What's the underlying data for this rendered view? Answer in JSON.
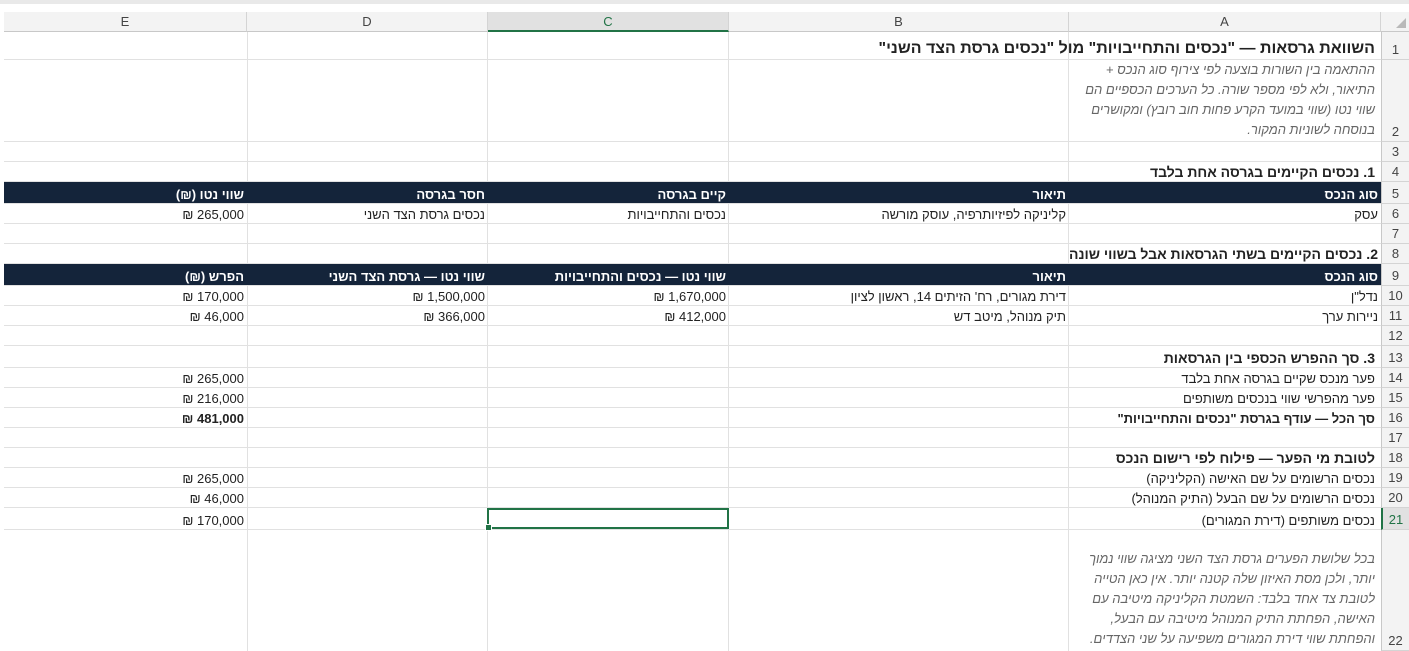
{
  "columns": [
    "E",
    "D",
    "C",
    "B",
    "A"
  ],
  "rows": [
    "1",
    "2",
    "3",
    "4",
    "5",
    "6",
    "7",
    "8",
    "9",
    "10",
    "11",
    "12",
    "13",
    "14",
    "15",
    "16",
    "17",
    "18",
    "19",
    "20",
    "21",
    "22"
  ],
  "title": "השוואת גרסאות — \"נכסים והתחייבויות\" מול \"נכסים גרסת הצד השני\"",
  "intro_note": "ההתאמה בין השורות בוצעה לפי צירוף סוג הנכס + התיאור, ולא לפי מספר שורה. כל הערכים הכספיים הם שווי נטו (שווי במועד הקרע פחות חוב רובץ) ומקושרים בנוסחה לשוניות המקור.",
  "section1": {
    "title": "1. נכסים הקיימים בגרסה אחת בלבד",
    "headers": [
      "סוג הנכס",
      "תיאור",
      "קיים בגרסה",
      "חסר בגרסה",
      "שווי נטו (₪)"
    ],
    "rows": [
      [
        "עסק",
        "קליניקה לפיזיותרפיה, עוסק מורשה",
        "נכסים והתחייבויות",
        "נכסים גרסת הצד השני",
        "₪ 265,000"
      ]
    ]
  },
  "section2": {
    "title": "2. נכסים הקיימים בשתי הגרסאות אבל בשווי שונה",
    "headers": [
      "סוג הנכס",
      "תיאור",
      "שווי נטו — נכסים והתחייבויות",
      "שווי נטו — גרסת הצד השני",
      "הפרש (₪)"
    ],
    "rows": [
      [
        "נדל\"ן",
        "דירת מגורים, רח' הזיתים 14, ראשון לציון",
        "₪ 1,670,000",
        "₪ 1,500,000",
        "₪ 170,000"
      ],
      [
        "ניירות ערך",
        "תיק מנוהל, מיטב דש",
        "₪ 412,000",
        "₪ 366,000",
        "₪ 46,000"
      ]
    ]
  },
  "section3": {
    "title": "3. סך ההפרש הכספי בין הגרסאות",
    "rows": [
      [
        "פער מנכס שקיים בגרסה אחת בלבד",
        "₪ 265,000"
      ],
      [
        "פער מהפרשי שווי בנכסים משותפים",
        "₪ 216,000"
      ],
      [
        "סך הכל — עודף בגרסת \"נכסים והתחייבויות\"",
        "₪ 481,000"
      ]
    ]
  },
  "section4": {
    "title": "לטובת מי הפער — פילוח לפי רישום הנכס",
    "rows": [
      [
        "נכסים הרשומים על שם האישה (הקליניקה)",
        "₪ 265,000"
      ],
      [
        "נכסים הרשומים על שם הבעל (התיק המנוהל)",
        "₪ 46,000"
      ],
      [
        "נכסים משותפים (דירת המגורים)",
        "₪ 170,000"
      ]
    ],
    "note": "בכל שלושת הפערים גרסת הצד השני מציגה שווי נמוך יותר, ולכן מסת האיזון שלה קטנה יותר. אין כאן הטייה לטובת צד אחד בלבד: השמטת הקליניקה מיטיבה עם האישה, הפחתת התיק המנוהל מיטיבה עם הבעל, והפחתת שווי דירת המגורים משפיעה על שני הצדדים."
  },
  "colors": {
    "header_bg": "#14243a",
    "accent": "#217346"
  }
}
